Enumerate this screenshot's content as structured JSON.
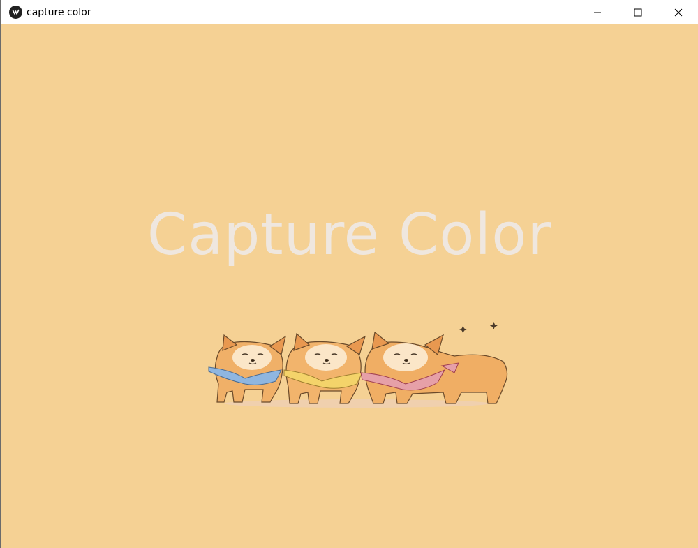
{
  "window": {
    "title": "capture color",
    "icon": "kivy-logo-icon",
    "controls": [
      "minimize-icon",
      "maximize-icon",
      "close-icon"
    ]
  },
  "main": {
    "heading": "Capture Color",
    "illustration": "three-shiba-dogs-with-bandanas"
  },
  "colors": {
    "background": "#f5d194",
    "heading": "#efe7df",
    "titlebar": "#ffffff"
  }
}
